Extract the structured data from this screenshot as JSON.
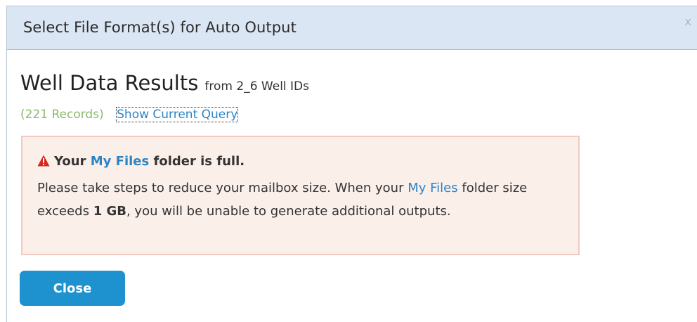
{
  "dialog": {
    "title": "Select File Format(s) for Auto Output",
    "close_glyph": "x"
  },
  "results": {
    "heading": "Well Data Results",
    "source": "from 2_6 Well IDs",
    "records": "(221 Records)",
    "query_link": "Show Current Query"
  },
  "alert": {
    "icon": "warning-triangle-icon",
    "head_prefix": "Your",
    "head_link": "My Files",
    "head_suffix": "folder is full.",
    "body_line1": "Please take steps to reduce your mailbox size. When your",
    "body_link": "My Files",
    "body_mid": "folder size exceeds",
    "body_limit": "1 GB",
    "body_end": ", you will be unable to generate additional outputs."
  },
  "buttons": {
    "close_label": "Close"
  },
  "colors": {
    "titlebar_bg": "#dbe6f4",
    "link": "#2b84c6",
    "records": "#8aba6a",
    "alert_bg": "#fbefea",
    "alert_border": "#f1cbc0",
    "warning": "#d9251c",
    "button": "#1d92cf"
  }
}
